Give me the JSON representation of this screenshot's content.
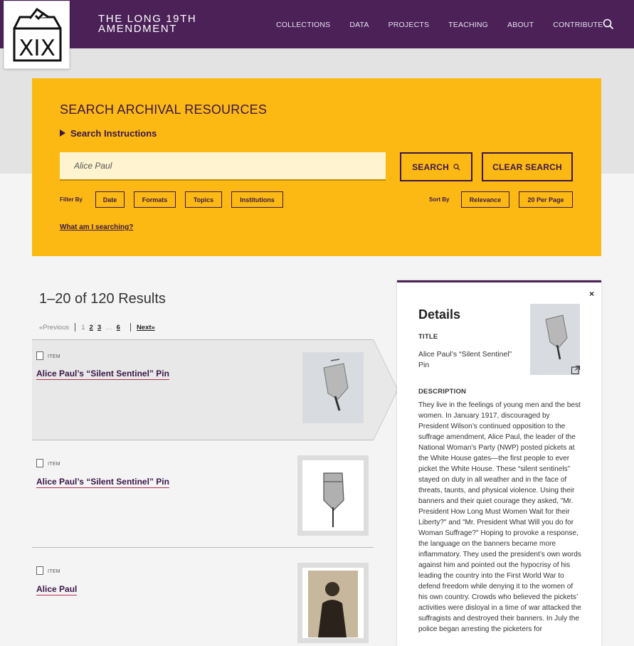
{
  "header": {
    "logo_text": "XIX",
    "site_title_line1": "THE LONG 19TH",
    "site_title_line2": "AMENDMENT",
    "nav": [
      "COLLECTIONS",
      "DATA",
      "PROJECTS",
      "TEACHING",
      "ABOUT",
      "CONTRIBUTE"
    ]
  },
  "search_panel": {
    "title": "SEARCH ARCHIVAL RESOURCES",
    "instructions_label": "Search Instructions",
    "query_value": "Alice Paul",
    "search_button": "SEARCH",
    "clear_button": "CLEAR SEARCH",
    "filter_label": "Filter By",
    "filters": [
      "Date",
      "Formats",
      "Topics",
      "Institutions"
    ],
    "sort_label": "Sort By",
    "sort_value": "Relevance",
    "per_page": "20 Per Page",
    "what_link": "What am I searching?"
  },
  "results": {
    "count_text": "1–20 of 120 Results",
    "pager": {
      "previous": "«Previous",
      "current": "1",
      "pages": [
        "2",
        "3"
      ],
      "ellipsis": "…",
      "last": "6",
      "next": "Next»"
    },
    "items": [
      {
        "type": "ITEM",
        "title": "Alice Paul’s “Silent Sentinel” Pin"
      },
      {
        "type": "ITEM",
        "title": "Alice Paul’s “Silent Sentinel” Pin"
      },
      {
        "type": "ITEM",
        "title": "Alice Paul"
      }
    ]
  },
  "details": {
    "close": "×",
    "heading": "Details",
    "title_label": "TITLE",
    "title_value": "Alice Paul’s “Silent Sentinel” Pin",
    "description_label": "DESCRIPTION",
    "description": "They live in the feelings of young men and the best women. In January 1917, discouraged by President Wilson’s continued opposition to the suffrage amendment, Alice Paul, the leader of the National Woman’s Party (NWP) posted pickets at the White House gates—the first people to ever picket the White House. These “silent sentinels” stayed on duty in all weather and in the face of threats, taunts, and physical violence. Using their banners and their quiet courage they asked, \"Mr. President How Long Must Women Wait for their Liberty?\" and \"Mr. President What Will you do for Woman Suffrage?\" Hoping to provoke a response, the language on the banners became more inflammatory. They used the president’s own words against him and pointed out the hypocrisy of his leading the country into the First World War to defend freedom while denying it to the women of his own country. Crowds who believed the pickets’ activities were disloyal in a time of war attacked the suffragists and destroyed their banners. In July the police began arresting the picketers for"
  },
  "colors": {
    "header_purple": "#4b2158",
    "panel_gold": "#fdb913",
    "accent_red": "#b62f52"
  }
}
